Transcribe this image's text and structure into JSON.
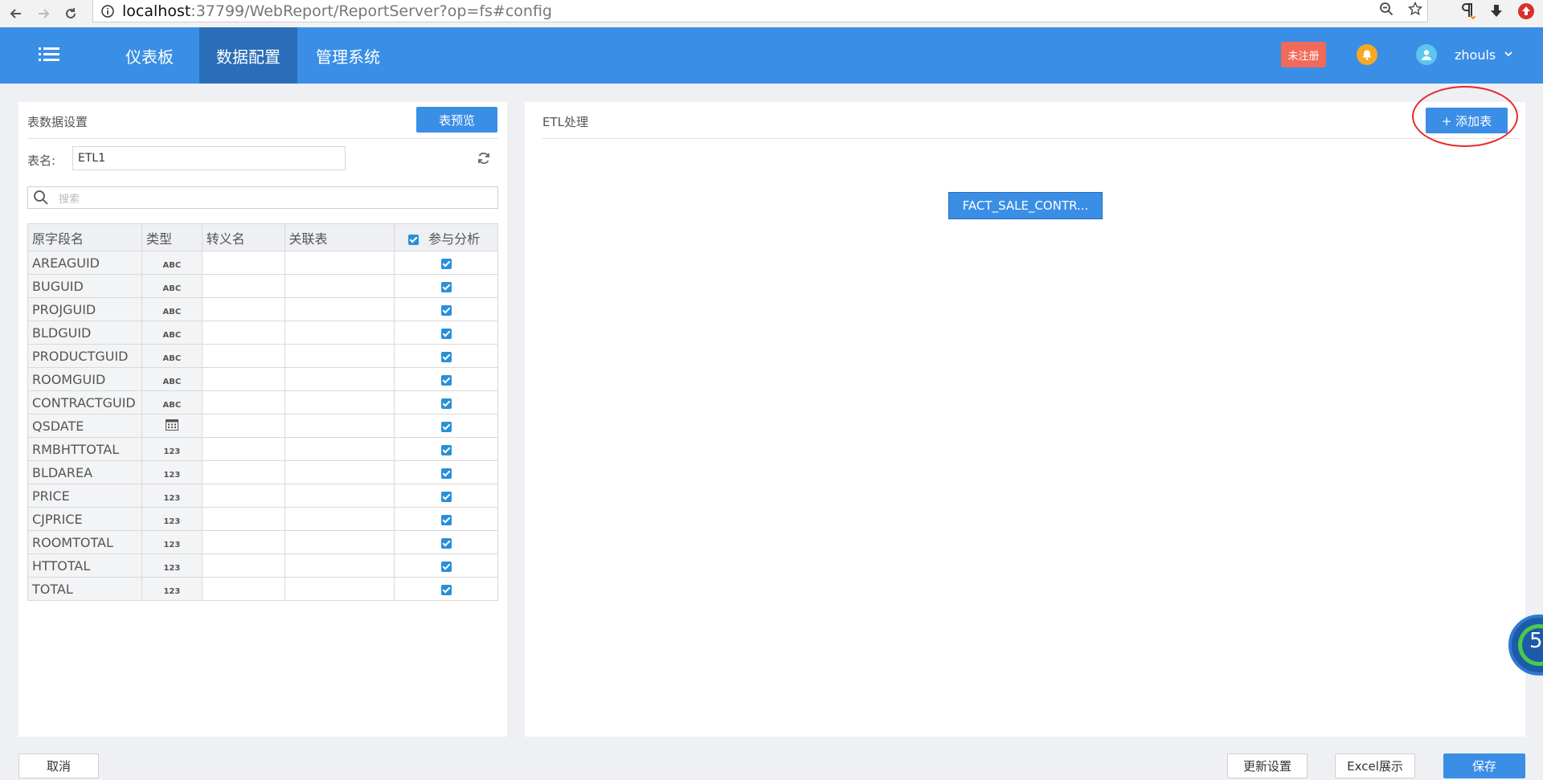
{
  "browser": {
    "url_host": "localhost",
    "url_rest": ":37799/WebReport/ReportServer?op=fs#config"
  },
  "header": {
    "tabs": [
      {
        "label": "仪表板"
      },
      {
        "label": "数据配置"
      },
      {
        "label": "管理系统"
      }
    ],
    "badge": "未注册",
    "username": "zhouls"
  },
  "left_panel": {
    "title": "表数据设置",
    "preview_button": "表预览",
    "table_name_label": "表名:",
    "table_name_value": "ETL1",
    "search_placeholder": "搜索",
    "columns": [
      "原字段名",
      "类型",
      "转义名",
      "关联表",
      "参与分析"
    ],
    "rows": [
      {
        "name": "AREAGUID",
        "type": "ABC"
      },
      {
        "name": "BUGUID",
        "type": "ABC"
      },
      {
        "name": "PROJGUID",
        "type": "ABC"
      },
      {
        "name": "BLDGUID",
        "type": "ABC"
      },
      {
        "name": "PRODUCTGUID",
        "type": "ABC"
      },
      {
        "name": "ROOMGUID",
        "type": "ABC"
      },
      {
        "name": "CONTRACTGUID",
        "type": "ABC"
      },
      {
        "name": "QSDATE",
        "type": "date"
      },
      {
        "name": "RMBHTTOTAL",
        "type": "123"
      },
      {
        "name": "BLDAREA",
        "type": "123"
      },
      {
        "name": "PRICE",
        "type": "123"
      },
      {
        "name": "CJPRICE",
        "type": "123"
      },
      {
        "name": "ROOMTOTAL",
        "type": "123"
      },
      {
        "name": "HTTOTAL",
        "type": "123"
      },
      {
        "name": "TOTAL",
        "type": "123"
      }
    ]
  },
  "right_panel": {
    "title": "ETL处理",
    "add_button": "+ 添加表",
    "node_label": "FACT_SALE_CONTR..."
  },
  "float_widget": {
    "value": "5"
  },
  "footer": {
    "cancel": "取消",
    "update_settings": "更新设置",
    "excel_show": "Excel展示",
    "save": "保存"
  },
  "colors": {
    "header_bg": "#3a8ee6",
    "active_tab_bg": "#2a6db8",
    "badge_bg": "#f06a5a",
    "highlight_ring": "#e8292b"
  }
}
